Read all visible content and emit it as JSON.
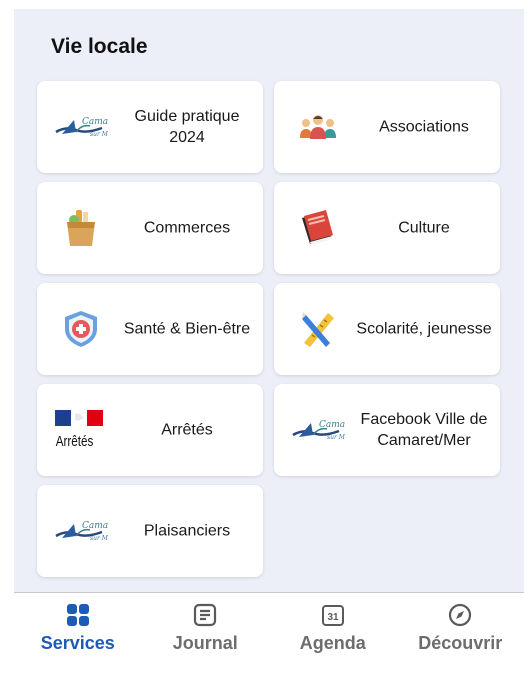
{
  "page": {
    "title": "Vie locale"
  },
  "cards": [
    {
      "label": "Guide pratique 2024",
      "icon": "camaret-logo-icon"
    },
    {
      "label": "Associations",
      "icon": "people-group-icon"
    },
    {
      "label": "Commerces",
      "icon": "grocery-bag-icon"
    },
    {
      "label": "Culture",
      "icon": "books-icon"
    },
    {
      "label": "Santé & Bien-être",
      "icon": "health-shield-icon"
    },
    {
      "label": "Scolarité, jeunesse",
      "icon": "ruler-pencil-icon"
    },
    {
      "label": "Arrêtés",
      "icon": "arretes-flag-icon",
      "icon_text": "Arrêtés"
    },
    {
      "label": "Facebook Ville de Camaret/Mer",
      "icon": "camaret-logo-icon"
    },
    {
      "label": "Plaisanciers",
      "icon": "camaret-logo-icon"
    }
  ],
  "bottom_nav": {
    "tabs": [
      {
        "label": "Services",
        "icon": "grid-icon",
        "active": true
      },
      {
        "label": "Journal",
        "icon": "journal-icon",
        "active": false
      },
      {
        "label": "Agenda",
        "icon": "calendar-icon",
        "icon_text": "31",
        "active": false
      },
      {
        "label": "Découvrir",
        "icon": "compass-icon",
        "active": false
      }
    ]
  },
  "colors": {
    "background": "#eceef8",
    "card": "#ffffff",
    "active_tab": "#1e5bb5",
    "inactive_tab": "#6d6d6d"
  }
}
